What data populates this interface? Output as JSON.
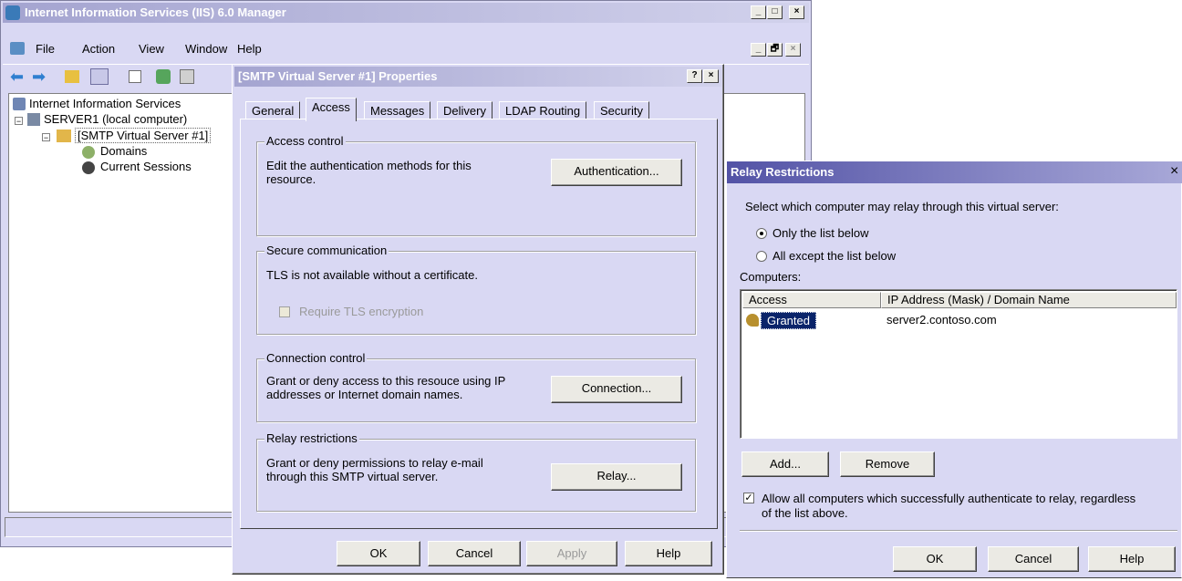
{
  "iis": {
    "title": "Internet Information Services (IIS) 6.0 Manager",
    "menu": [
      "File",
      "Action",
      "View",
      "Window",
      "Help"
    ],
    "tree": {
      "root": "Internet Information Services",
      "server": "SERVER1 (local computer)",
      "smtp": "[SMTP Virtual Server #1]",
      "domains": "Domains",
      "sessions": "Current Sessions"
    },
    "title_buttons": [
      "_",
      "□",
      "×"
    ],
    "menu_buttons": [
      "_",
      "🗗",
      "×"
    ]
  },
  "props": {
    "title": "[SMTP Virtual Server #1] Properties",
    "title_help": "?",
    "title_close": "×",
    "tabs": [
      "General",
      "Access",
      "Messages",
      "Delivery",
      "LDAP Routing",
      "Security"
    ],
    "access_control": {
      "label": "Access control",
      "text": "Edit the authentication methods for this resource.",
      "button": "Authentication..."
    },
    "secure": {
      "label": "Secure communication",
      "text": "TLS is not available without a certificate.",
      "checkbox": "Require TLS encryption"
    },
    "connection": {
      "label": "Connection control",
      "text": "Grant or deny access to this resouce using IP addresses or Internet domain names.",
      "button": "Connection..."
    },
    "relay": {
      "label": "Relay restrictions",
      "text": "Grant or deny permissions to relay e-mail through this SMTP virtual server.",
      "button": "Relay..."
    },
    "buttons": {
      "ok": "OK",
      "cancel": "Cancel",
      "apply": "Apply",
      "help": "Help"
    }
  },
  "relay": {
    "title": "Relay Restrictions",
    "close": "×",
    "instruction": "Select which computer may relay through this virtual server:",
    "radio_only": "Only the list below",
    "radio_all": "All except the list below",
    "radio_selected": "only",
    "computers_label": "Computers:",
    "columns": [
      "Access",
      "IP Address (Mask) / Domain Name"
    ],
    "rows": [
      {
        "access": "Granted",
        "address": "server2.contoso.com"
      }
    ],
    "add": "Add...",
    "remove": "Remove",
    "allow_checked": true,
    "allow_line1": "Allow all computers which successfully authenticate to relay, regardless",
    "allow_line2": "of the list above.",
    "buttons": {
      "ok": "OK",
      "cancel": "Cancel",
      "help": "Help"
    }
  },
  "colors": {
    "dialog_bg": "#d9d8f3",
    "title_active": "#5353a6",
    "title_inactive": "#a4a4d0",
    "selection": "#0a246a"
  }
}
